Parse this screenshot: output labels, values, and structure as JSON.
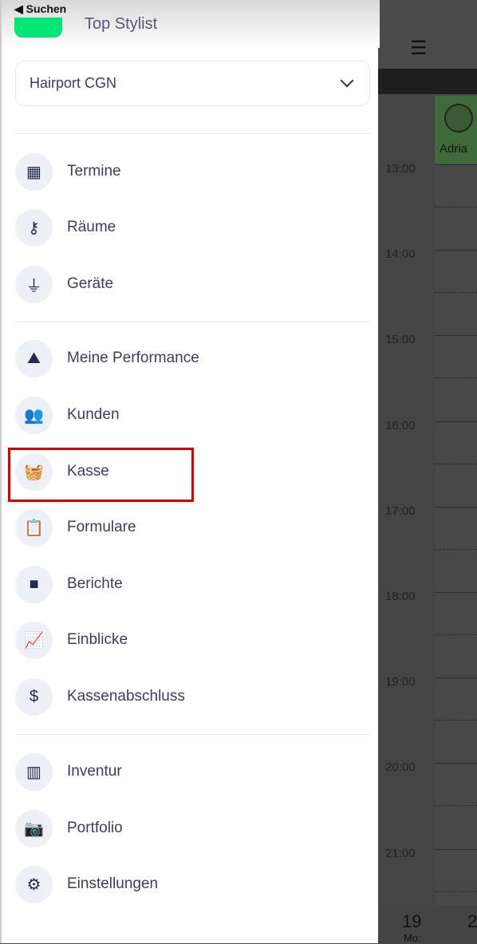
{
  "status": {
    "back_label": "◀ Suchen"
  },
  "header": {
    "user_title": "Top Stylist",
    "location": "Hairport CGN"
  },
  "menu": [
    {
      "label": "Termine",
      "icon": "calendar-icon",
      "glyph": "▦"
    },
    {
      "label": "Räume",
      "icon": "key-icon",
      "glyph": "⚷"
    },
    {
      "label": "Geräte",
      "icon": "plug-icon",
      "glyph": "⏚"
    },
    {
      "label": "Meine Performance",
      "icon": "mountain-flag-icon",
      "glyph": "⛰"
    },
    {
      "label": "Kunden",
      "icon": "users-icon",
      "glyph": "👥"
    },
    {
      "label": "Kasse",
      "icon": "basket-icon",
      "glyph": "🧺"
    },
    {
      "label": "Formulare",
      "icon": "clipboard-icon",
      "glyph": "📋"
    },
    {
      "label": "Berichte",
      "icon": "folder-icon",
      "glyph": "■"
    },
    {
      "label": "Einblicke",
      "icon": "chart-presentation-icon",
      "glyph": "📈"
    },
    {
      "label": "Kassenabschluss",
      "icon": "dollar-circle-icon",
      "glyph": "$"
    },
    {
      "label": "Inventur",
      "icon": "barcode-icon",
      "glyph": "▥"
    },
    {
      "label": "Portfolio",
      "icon": "camera-icon",
      "glyph": "📷"
    },
    {
      "label": "Einstellungen",
      "icon": "gear-icon",
      "glyph": "⚙"
    }
  ],
  "highlight": {
    "item": "Kasse",
    "color": "#e00000"
  },
  "calendar": {
    "staff": "Adria",
    "times": [
      "13:00",
      "14:00",
      "15:00",
      "16:00",
      "17:00",
      "18:00",
      "19:00",
      "20:00",
      "21:00"
    ],
    "day_number": "19",
    "day_name": "Mo.",
    "next_day": "2"
  },
  "colors": {
    "avatar": "#00e676",
    "icon_bg": "#eef0f7",
    "icon": "#232a4e"
  }
}
